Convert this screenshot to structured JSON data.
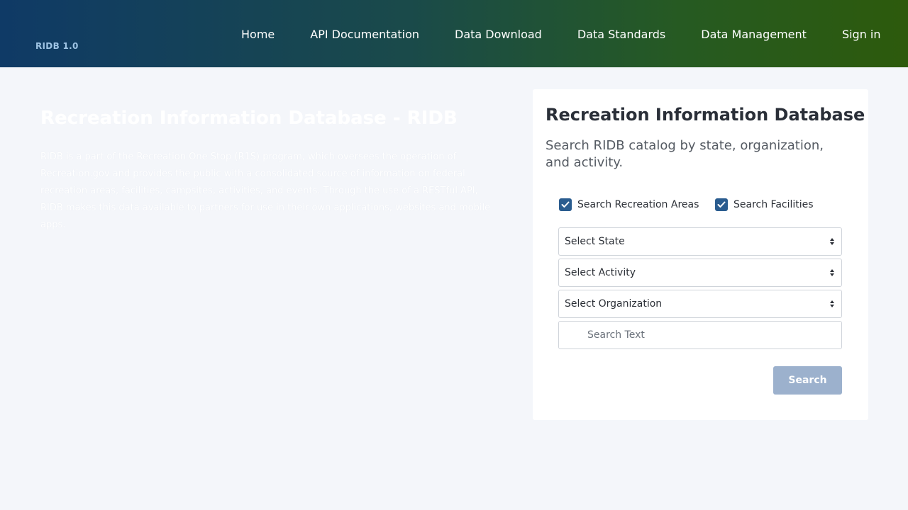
{
  "header": {
    "logo": "RIDB 1.0",
    "nav": [
      "Home",
      "API Documentation",
      "Data Download",
      "Data Standards",
      "Data Management",
      "Sign in"
    ]
  },
  "hero": {
    "title": "Recreation Information Database - RIDB",
    "text": "RIDB is a part of the Recreation One Stop (R1S) program, which oversees the operation of Recreation.gov and provides the public with a consolidated source of information on federal recreation areas, facilities, campsites, activities, and events. Through the use of a RESTful API, RIDB makes this data available to partners for use in their own applications, websites and mobile apps."
  },
  "search": {
    "title": "Recreation Information Database",
    "subtitle": "Search RIDB catalog by state, organization, and activity.",
    "check_areas": "Search Recreation Areas",
    "check_facilities": "Search Facilities",
    "state": "Select State",
    "activity": "Select Activity",
    "organization": "Select Organization",
    "search_placeholder": "Search Text",
    "button": "Search"
  },
  "colors": {
    "accent": "#2a5c8f",
    "button": "#9cb1cd",
    "logo": "#9fc4e4"
  },
  "icons": {
    "checkbox": "check-icon",
    "select": "sort-arrows-icon"
  }
}
